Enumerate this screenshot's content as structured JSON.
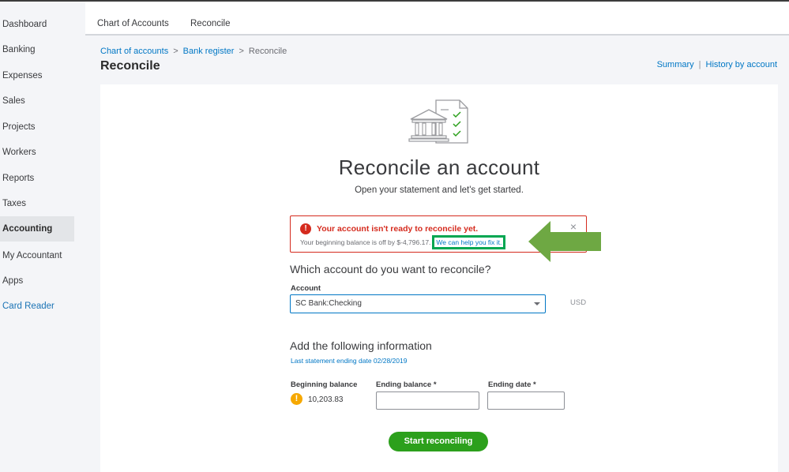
{
  "sidebar": {
    "items": [
      {
        "label": "Dashboard"
      },
      {
        "label": "Banking"
      },
      {
        "label": "Expenses"
      },
      {
        "label": "Sales"
      },
      {
        "label": "Projects"
      },
      {
        "label": "Workers"
      },
      {
        "label": "Reports"
      },
      {
        "label": "Taxes"
      },
      {
        "label": "Accounting",
        "active": true
      },
      {
        "label": "My Accountant"
      },
      {
        "label": "Apps"
      },
      {
        "label": "Card Reader"
      }
    ]
  },
  "tabs": [
    {
      "label": "Chart of Accounts"
    },
    {
      "label": "Reconcile",
      "active": true
    }
  ],
  "breadcrumb": {
    "items": [
      "Chart of accounts",
      "Bank register",
      "Reconcile"
    ],
    "separator": ">"
  },
  "page": {
    "title": "Reconcile",
    "links": {
      "summary": "Summary",
      "history": "History by account",
      "divider": "|"
    }
  },
  "hero": {
    "icon": "bank-checklist-icon",
    "title": "Reconcile an account",
    "subtitle": "Open your statement and let's get started."
  },
  "alert": {
    "icon": "!",
    "title": "Your account isn't ready to reconcile yet.",
    "text": "Your beginning balance is off by $-4,796.17.",
    "link": "We can help you fix it.",
    "close": "×"
  },
  "account_section": {
    "question": "Which account do you want to reconcile?",
    "account_label": "Account",
    "account_value": "SC Bank:Checking",
    "currency": "USD"
  },
  "info_section": {
    "title": "Add the following information",
    "last_statement": "Last statement ending date 02/28/2019",
    "beginning_balance_label": "Beginning balance",
    "beginning_balance_value": "10,203.83",
    "ending_balance_label": "Ending balance *",
    "ending_date_label": "Ending date *",
    "warning_icon": "!"
  },
  "actions": {
    "start": "Start reconciling"
  },
  "colors": {
    "accent_blue": "#0077c5",
    "alert_red": "#d52b1e",
    "primary_green": "#2ca01c",
    "annotation_green": "#00a651",
    "arrow_green": "#6ea843",
    "warning_orange": "#f6a800"
  }
}
